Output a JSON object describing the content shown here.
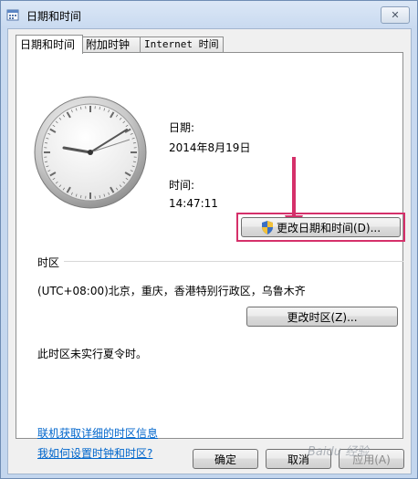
{
  "window": {
    "title": "日期和时间",
    "close_symbol": "✕"
  },
  "tabs": [
    {
      "label": "日期和时间",
      "active": true
    },
    {
      "label": "附加时钟",
      "active": false
    },
    {
      "label": "Internet 时间",
      "active": false
    }
  ],
  "datetime": {
    "date_label": "日期:",
    "date_value": "2014年8月19日",
    "time_label": "时间:",
    "time_value": "14:47:11",
    "change_button": "更改日期和时间(D)..."
  },
  "timezone": {
    "section_label": "时区",
    "value": "(UTC+08:00)北京，重庆，香港特别行政区，乌鲁木齐",
    "change_button": "更改时区(Z)...",
    "dst_note": "此时区未实行夏令时。"
  },
  "links": {
    "online_info": "联机获取详细的时区信息",
    "how_to": "我如何设置时钟和时区?"
  },
  "footer": {
    "ok": "确定",
    "cancel": "取消",
    "apply": "应用(A)"
  },
  "watermark": "Baidu 经验",
  "colors": {
    "highlight": "#d5306a",
    "link": "#0066cc"
  },
  "icons": {
    "title": "calendar-icon",
    "shield": "uac-shield-icon",
    "arrow": "pink-down-arrow"
  }
}
